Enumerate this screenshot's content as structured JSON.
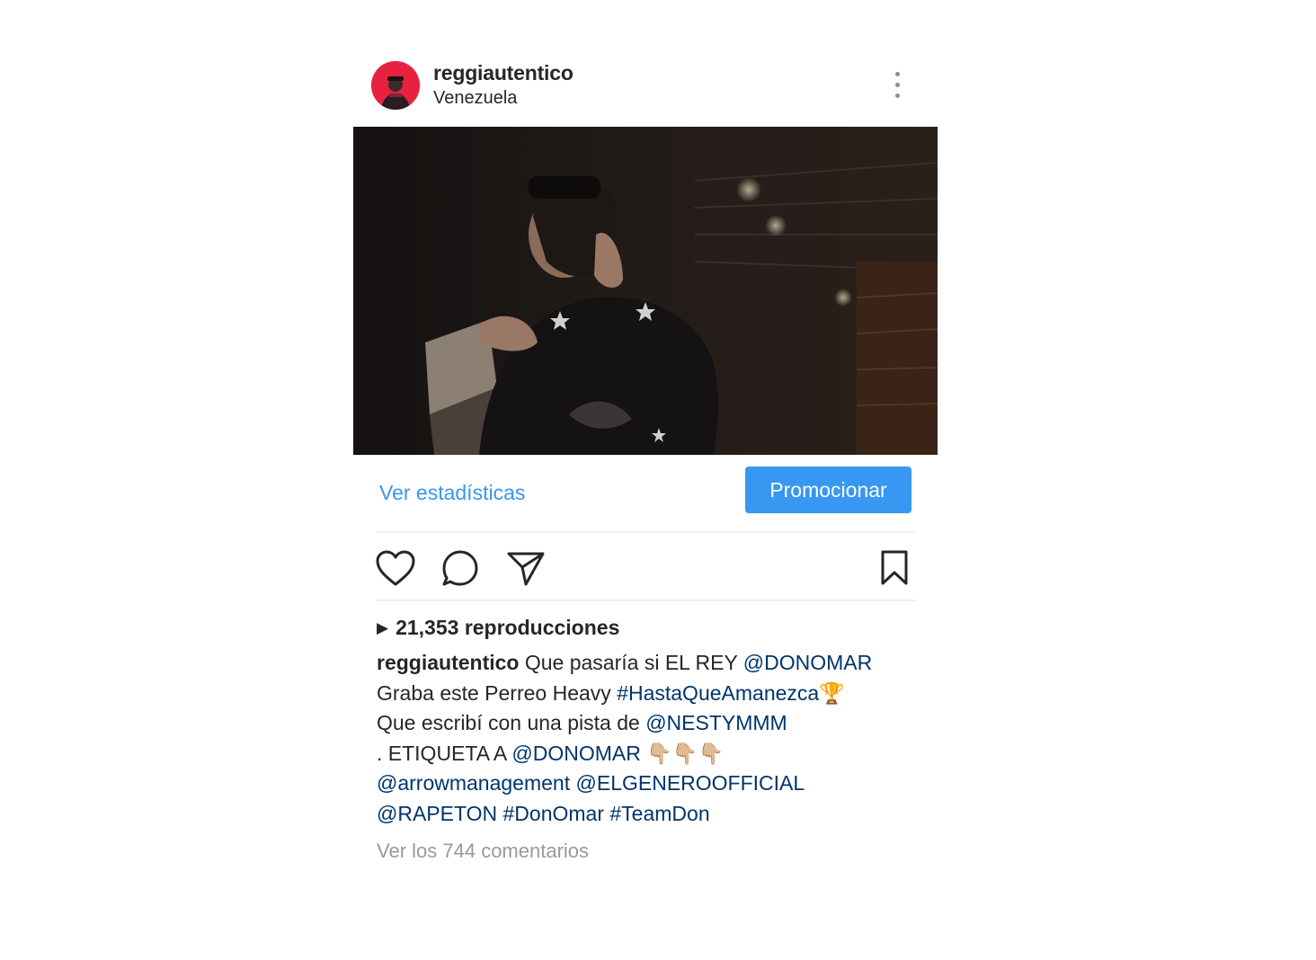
{
  "post": {
    "username": "reggiautentico",
    "location": "Venezuela",
    "media_description_icon": "video-frame",
    "insights_label": "Ver estadísticas",
    "promote_label": "Promocionar",
    "views": "21,353 reproducciones",
    "play_icon": "play-icon",
    "caption": {
      "user": "reggiautentico",
      "t1": " Que pasaría si EL REY ",
      "m1": "@DONOMAR",
      "t2": " Graba este Perreo Heavy ",
      "h1": "#HastaQueAmanezca",
      "e1": "🏆",
      "t3": " Que escribí con una pista de ",
      "m2": "@NESTYMMM",
      "t4": " . ETIQUETA A ",
      "m3": "@DONOMAR",
      "e2": " 👇🏼👇🏼👇🏼",
      "m4": "@arrowmanagement",
      "t5": " ",
      "m5": "@ELGENEROOFFICIAL",
      "m6": "@RAPETON",
      "h2": "#DonOmar",
      "h3": "#TeamDon"
    },
    "comments_link": "Ver los 744 comentarios"
  },
  "colors": {
    "accent": "#3897f0",
    "link": "#003569",
    "muted": "#999999",
    "avatar_bg": "#e8213f"
  }
}
